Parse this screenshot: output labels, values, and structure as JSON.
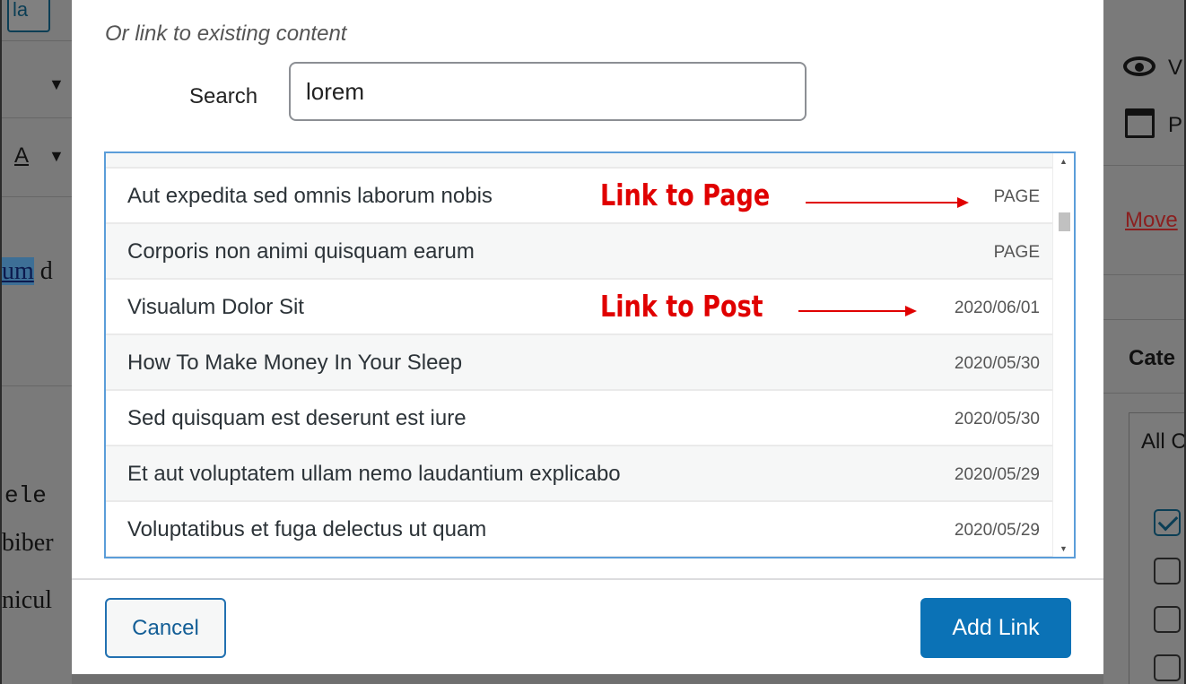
{
  "background": {
    "left_button_label": "la",
    "left_underlined_text": "um",
    "left_trailing_text": "d",
    "left_code_text": "ele",
    "left_lines": [
      "biber",
      "nicul"
    ],
    "right_eye_text": "V",
    "right_calendar_text": "P",
    "right_link": "Move",
    "right_heading": "Cate",
    "right_all": "All C"
  },
  "dialog": {
    "section_title": "Or link to existing content",
    "search": {
      "label": "Search",
      "value": "lorem"
    },
    "results": [
      {
        "title": "Aut expedita sed omnis laborum nobis",
        "info": "PAGE"
      },
      {
        "title": "Corporis non animi quisquam earum",
        "info": "PAGE"
      },
      {
        "title": "Visualum Dolor Sit",
        "info": "2020/06/01"
      },
      {
        "title": "How To Make Money In Your Sleep",
        "info": "2020/05/30"
      },
      {
        "title": "Sed quisquam est deserunt est iure",
        "info": "2020/05/30"
      },
      {
        "title": "Et aut voluptatem ullam nemo laudantium explicabo",
        "info": "2020/05/29"
      },
      {
        "title": "Voluptatibus et fuga delectus ut quam",
        "info": "2020/05/29"
      }
    ],
    "annotations": {
      "page": "Link to Page",
      "post": "Link to Post"
    },
    "buttons": {
      "cancel": "Cancel",
      "add_link": "Add Link"
    }
  },
  "colors": {
    "primary": "#0b72b6",
    "focus_border": "#5b9dd9",
    "annotation": "#e00000",
    "overlay": "#7a7a7a"
  },
  "icons": [
    "eye-icon",
    "calendar-icon",
    "scroll-up-icon",
    "scroll-down-icon",
    "arrow-icon",
    "checkbox-icon"
  ]
}
